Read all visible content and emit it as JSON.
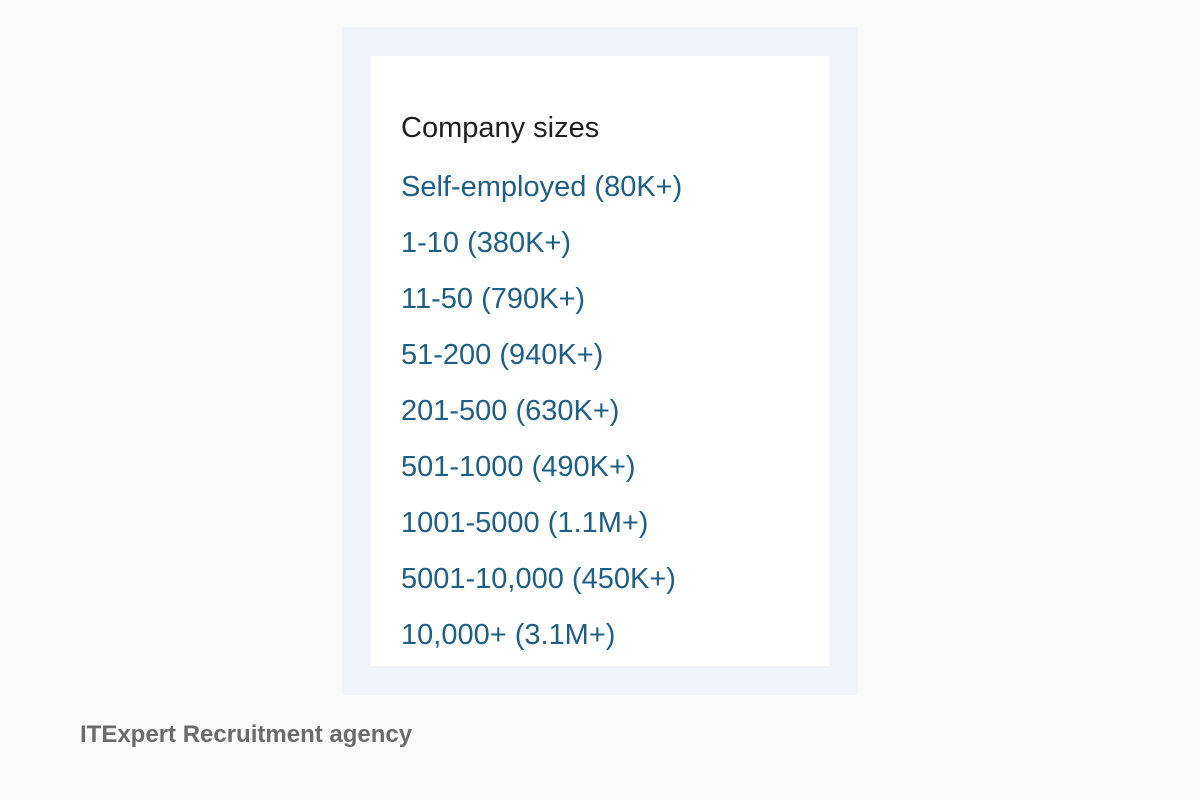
{
  "panel": {
    "title": "Company sizes",
    "items": [
      {
        "label": "Self-employed (80K+)"
      },
      {
        "label": "1-10 (380K+)"
      },
      {
        "label": "11-50 (790K+)"
      },
      {
        "label": "51-200 (940K+)"
      },
      {
        "label": "201-500 (630K+)"
      },
      {
        "label": "501-1000 (490K+)"
      },
      {
        "label": "1001-5000 (1.1M+)"
      },
      {
        "label": "5001-10,000 (450K+)"
      },
      {
        "label": "10,000+ (3.1M+)"
      }
    ]
  },
  "caption": "ITExpert Recruitment agency",
  "colors": {
    "page_background": "#fafafa",
    "panel_background": "#f1f4f8",
    "card_background": "#ffffff",
    "link": "#1f5f85",
    "title": "#1d1d1d",
    "caption": "#6b6b6b"
  }
}
